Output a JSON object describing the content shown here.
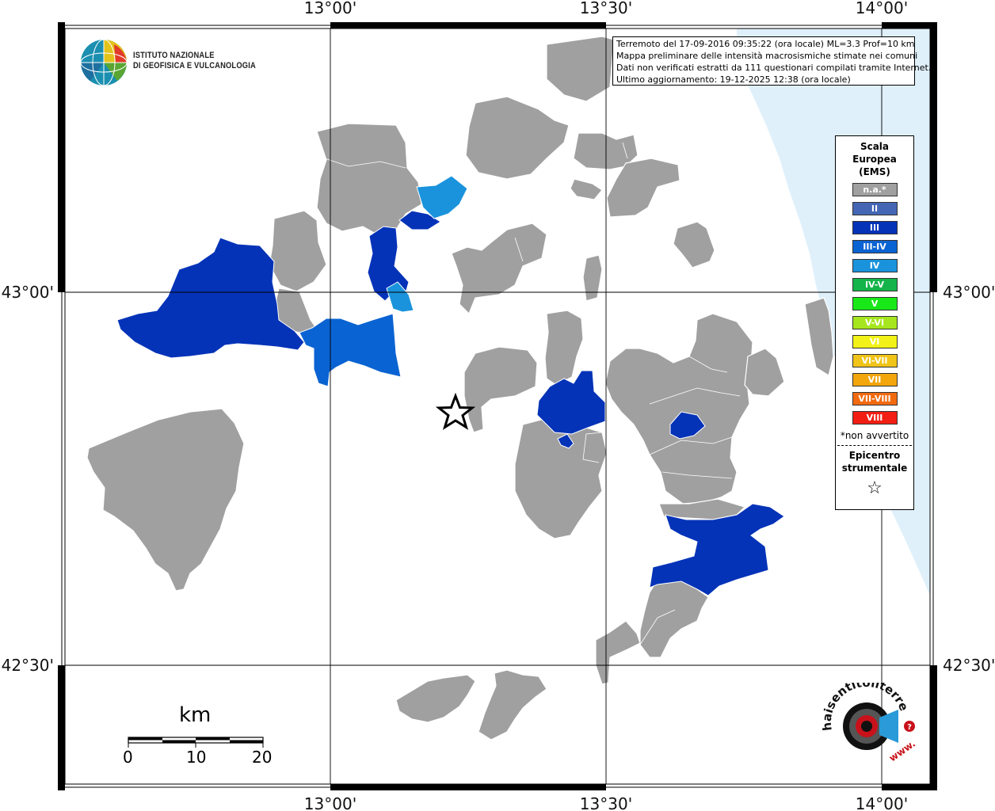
{
  "map": {
    "lon_labels": [
      "13°00'",
      "13°30'",
      "14°00'"
    ],
    "lat_labels": [
      "43°00'",
      "42°30'"
    ],
    "colors": {
      "na": "#a0a0a0",
      "III": "#0433b8",
      "III-IV": "#0a63d2",
      "IV": "#1a93dc",
      "sea": "#dff0fb",
      "frame": "#000000",
      "grid": "#000000"
    }
  },
  "info": {
    "line1": "Terremoto del 17-09-2016 09:35:22 (ora locale) ML=3.3 Prof=10 km",
    "line2": "Mappa preliminare delle intensità macrosismiche stimate nei comuni",
    "line3": "Dati non verificati estratti da 111 questionari compilati tramite Internet.",
    "line4": "Ultimo aggiornamento: 19-12-2025 12:38 (ora locale)"
  },
  "legend": {
    "title1": "Scala",
    "title2": "Europea",
    "title3": "(EMS)",
    "items": [
      {
        "label": "n.a.*",
        "color": "#a0a0a0"
      },
      {
        "label": "II",
        "color": "#4466b4"
      },
      {
        "label": "III",
        "color": "#0433b8"
      },
      {
        "label": "III-IV",
        "color": "#0a63d2"
      },
      {
        "label": "IV",
        "color": "#1a93dc"
      },
      {
        "label": "IV-V",
        "color": "#14b44a"
      },
      {
        "label": "V",
        "color": "#18e818"
      },
      {
        "label": "V-VI",
        "color": "#a6e61e"
      },
      {
        "label": "VI",
        "color": "#f2f218"
      },
      {
        "label": "VI-VII",
        "color": "#f0c418"
      },
      {
        "label": "VII",
        "color": "#f2a60c"
      },
      {
        "label": "VII-VIII",
        "color": "#f26a10"
      },
      {
        "label": "VIII",
        "color": "#f21e14"
      }
    ],
    "note": "*non avvertito",
    "epicenter1": "Epicentro",
    "epicenter2": "strumentale",
    "star": "☆"
  },
  "scale": {
    "title": "km",
    "labels": [
      "0",
      "10",
      "20"
    ]
  },
  "ingv": {
    "line1": "ISTITUTO NAZIONALE",
    "line2": "DI GEOFISICA E VULCANOLOGIA"
  },
  "hst": {
    "text1": "haisentitoilterremoto.it",
    "text2": "www."
  }
}
